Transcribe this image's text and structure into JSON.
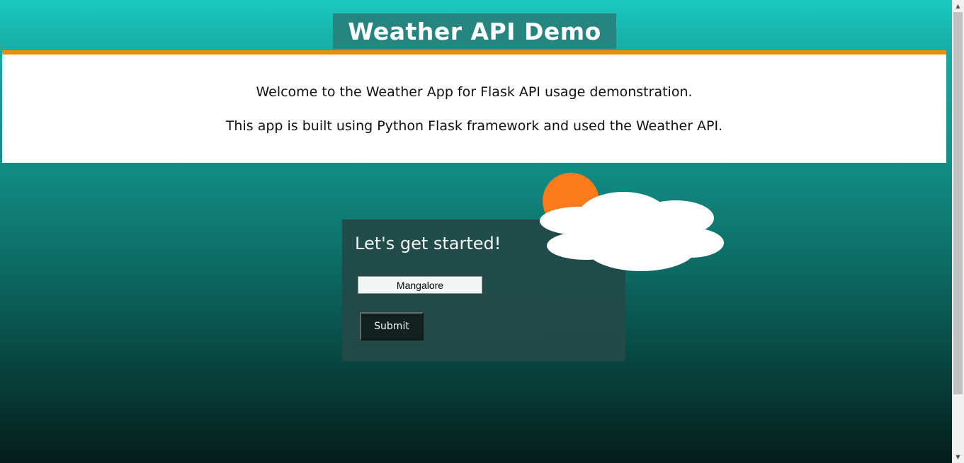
{
  "header": {
    "title": "Weather API Demo"
  },
  "banner": {
    "line1": "Welcome to the Weather App for Flask API usage demonstration.",
    "line2": "This app is built using Python Flask framework and used the Weather API."
  },
  "form": {
    "heading": "Let's get started!",
    "city_value": "Mangalore",
    "submit_label": "Submit"
  },
  "decor": {
    "sun_icon": "sun-icon",
    "cloud_icon": "cloud-icon",
    "sun_color": "#fb7b1a",
    "cloud_color": "#ffffff",
    "accent_color": "#f08a00"
  },
  "scrollbar": {
    "up_glyph": "▲",
    "down_glyph": "▼"
  }
}
